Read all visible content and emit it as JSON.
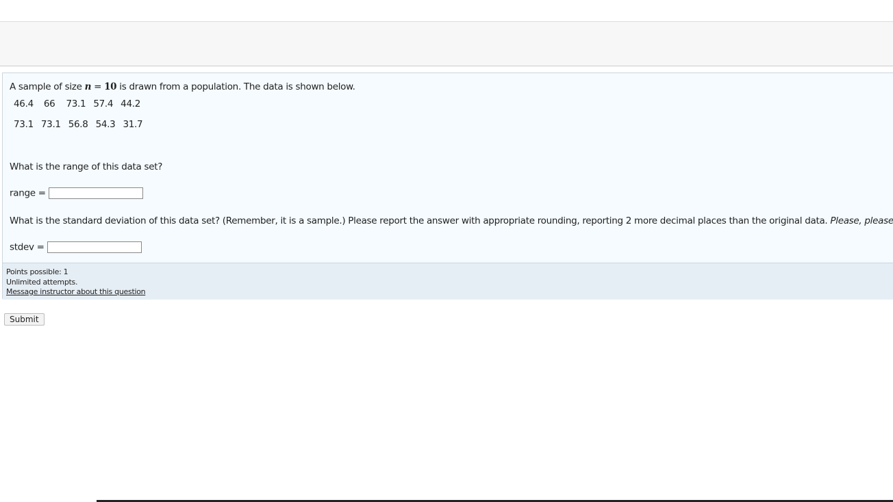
{
  "question": {
    "intro_pre": "A sample of size ",
    "intro_math_var": "n",
    "intro_math_eq": " = ",
    "intro_math_val": "10",
    "intro_post": " is drawn from a population. The data is shown below.",
    "data_rows": [
      [
        "46.4",
        "66",
        "73.1",
        "57.4",
        "44.2"
      ],
      [
        "73.1",
        "73.1",
        "56.8",
        "54.3",
        "31.7"
      ]
    ],
    "q1": "What is the range of this data set?",
    "range_label": "range =",
    "range_value": "",
    "q2": "What is the standard deviation of this data set? (Remember, it is a sample.) Please report the answer with appropriate rounding, reporting 2 more decimal places than the original data. ",
    "q2_italic": "Please, please, please c",
    "stdev_label": "stdev =",
    "stdev_value": ""
  },
  "footer": {
    "points": "Points possible: 1",
    "attempts": "Unlimited attempts.",
    "message_link": "Message instructor about this question"
  },
  "submit_label": "Submit"
}
